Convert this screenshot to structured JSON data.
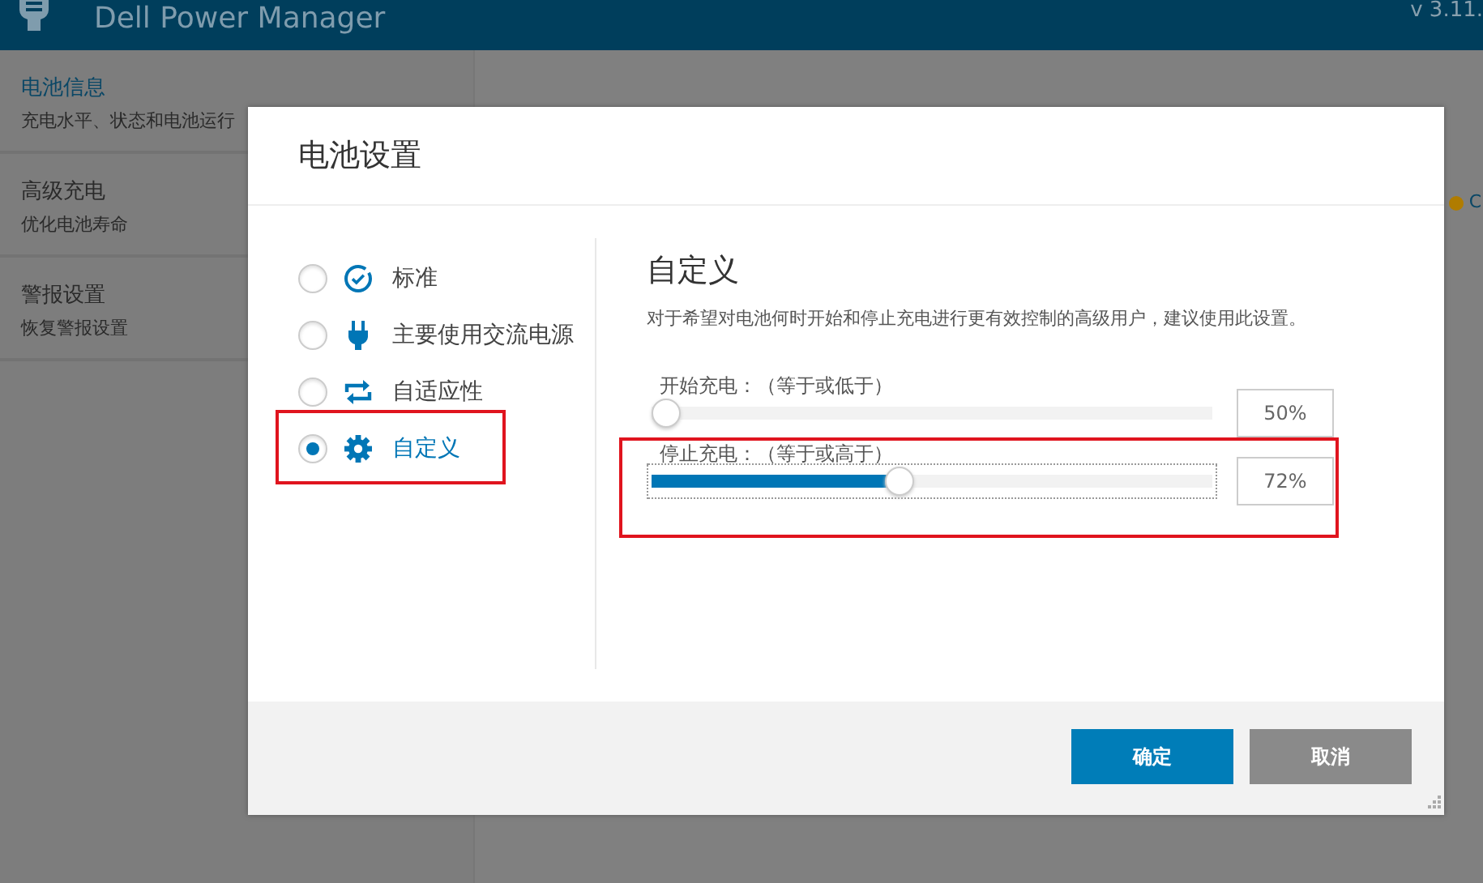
{
  "app": {
    "title": "Dell Power Manager",
    "version": "v 3.11."
  },
  "sidebar": {
    "items": [
      {
        "title": "电池信息",
        "subtitle": "充电水平、状态和电池运行",
        "selected": true
      },
      {
        "title": "高级充电",
        "subtitle": "优化电池寿命",
        "selected": false
      },
      {
        "title": "警报设置",
        "subtitle": "恢复警报设置",
        "selected": false
      }
    ]
  },
  "status": {
    "color": "#b07c00",
    "label": "C"
  },
  "dialog": {
    "title": "电池设置",
    "options": [
      {
        "kind": "clock",
        "label": "标准",
        "selected": false,
        "highlighted": false
      },
      {
        "kind": "plug",
        "label": "主要使用交流电源",
        "selected": false,
        "highlighted": false
      },
      {
        "kind": "cycle",
        "label": "自适应性",
        "selected": false,
        "highlighted": false
      },
      {
        "kind": "gear",
        "label": "自定义",
        "selected": true,
        "highlighted": true
      }
    ],
    "panel": {
      "heading": "自定义",
      "description": "对于希望对电池何时开始和停止充电进行更有效控制的高级用户，建议使用此设置。",
      "sliders": [
        {
          "label": "开始充电：（等于或低于）",
          "level": 0,
          "reading": "50%",
          "focused": false,
          "highlighted": false
        },
        {
          "label": "停止充电：（等于或高于）",
          "level": 0.44,
          "reading": "72%",
          "focused": true,
          "highlighted": true
        }
      ]
    },
    "buttons": [
      {
        "kind": "primary",
        "label": "确定"
      },
      {
        "kind": "secondary",
        "label": "取消"
      }
    ]
  }
}
